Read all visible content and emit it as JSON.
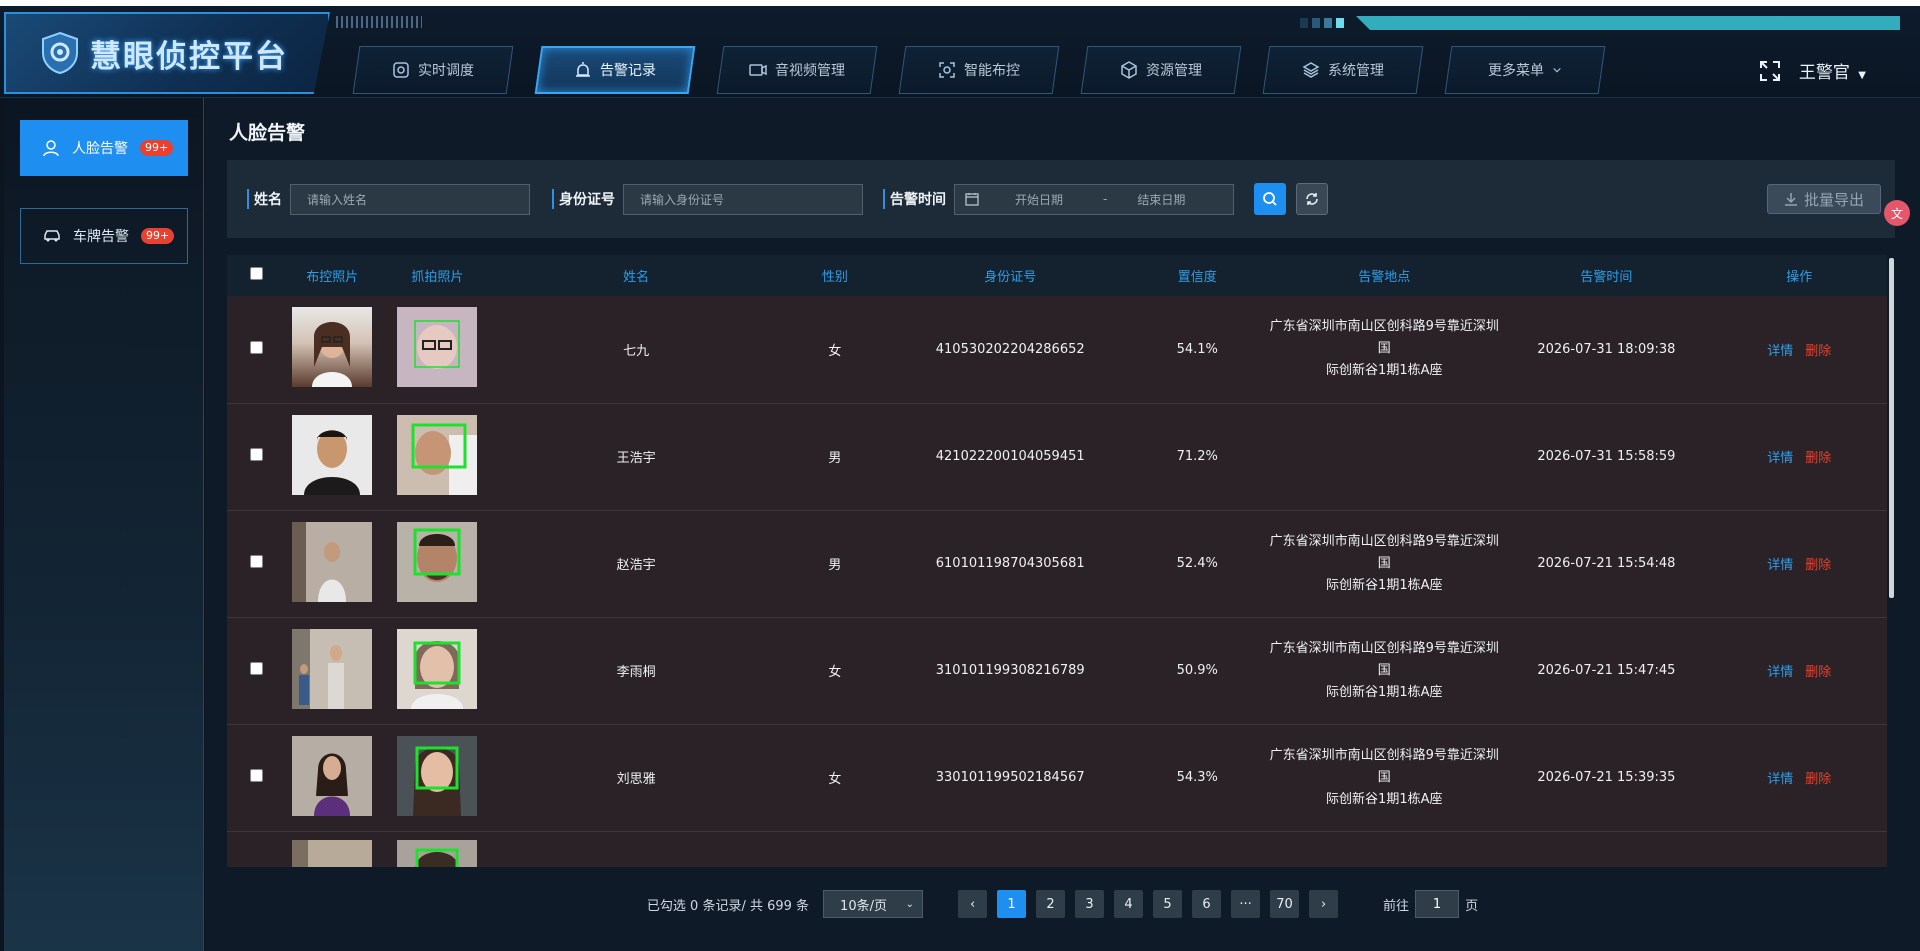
{
  "app": {
    "title": "慧眼侦控平台"
  },
  "nav": {
    "items": [
      {
        "label": "实时调度",
        "icon": "dispatch-icon"
      },
      {
        "label": "告警记录",
        "icon": "alarm-icon",
        "active": true
      },
      {
        "label": "音视频管理",
        "icon": "video-icon"
      },
      {
        "label": "智能布控",
        "icon": "smart-deploy-icon"
      },
      {
        "label": "资源管理",
        "icon": "cube-icon"
      },
      {
        "label": "系统管理",
        "icon": "layers-icon"
      },
      {
        "label": "更多菜单",
        "icon": "chevron-down-icon"
      }
    ]
  },
  "user": {
    "name": "王警官"
  },
  "sidebar": {
    "items": [
      {
        "label": "人脸告警",
        "badge": "99+",
        "active": true
      },
      {
        "label": "车牌告警",
        "badge": "99+",
        "active": false
      }
    ]
  },
  "page": {
    "title": "人脸告警"
  },
  "filters": {
    "name_label": "姓名",
    "name_placeholder": "请输入姓名",
    "id_label": "身份证号",
    "id_placeholder": "请输入身份证号",
    "time_label": "告警时间",
    "start_placeholder": "开始日期",
    "range_sep": "-",
    "end_placeholder": "结束日期",
    "export_label": "批量导出"
  },
  "table": {
    "headers": [
      "布控照片",
      "抓拍照片",
      "姓名",
      "性别",
      "身份证号",
      "置信度",
      "告警地点",
      "告警时间",
      "操作"
    ],
    "detail_label": "详情",
    "delete_label": "删除",
    "rows": [
      {
        "name": "七九",
        "gender": "女",
        "id": "410530202204286652",
        "confidence": "54.1%",
        "location_line1": "广东省深圳市南山区创科路9号靠近深圳国",
        "location_line2": "际创新谷1期1栋A座",
        "time": "2026-07-31 18:09:38"
      },
      {
        "name": "王浩宇",
        "gender": "男",
        "id": "421022200104059451",
        "confidence": "71.2%",
        "location_line1": "",
        "location_line2": "",
        "time": "2026-07-31 15:58:59"
      },
      {
        "name": "赵浩宇",
        "gender": "男",
        "id": "610101198704305681",
        "confidence": "52.4%",
        "location_line1": "广东省深圳市南山区创科路9号靠近深圳国",
        "location_line2": "际创新谷1期1栋A座",
        "time": "2026-07-21 15:54:48"
      },
      {
        "name": "李雨桐",
        "gender": "女",
        "id": "310101199308216789",
        "confidence": "50.9%",
        "location_line1": "广东省深圳市南山区创科路9号靠近深圳国",
        "location_line2": "际创新谷1期1栋A座",
        "time": "2026-07-21 15:47:45"
      },
      {
        "name": "刘思雅",
        "gender": "女",
        "id": "330101199502184567",
        "confidence": "54.3%",
        "location_line1": "广东省深圳市南山区创科路9号靠近深圳国",
        "location_line2": "际创新谷1期1栋A座",
        "time": "2026-07-21 15:39:35"
      }
    ]
  },
  "pagination": {
    "summary": "已勾选 0 条记录/ 共 699 条",
    "page_size": "10条/页",
    "pages": [
      "1",
      "2",
      "3",
      "4",
      "5",
      "6",
      "···",
      "70"
    ],
    "current": "1",
    "goto_label": "前往",
    "goto_value": "1",
    "goto_suffix": "页"
  },
  "colors": {
    "accent": "#1f8ef1",
    "danger": "#e8412f",
    "face_box": "#1de22d"
  }
}
